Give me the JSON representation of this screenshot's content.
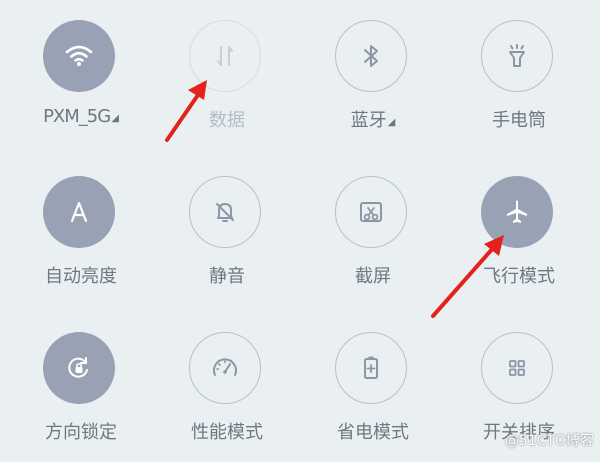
{
  "tiles": [
    {
      "label": "PXM_5G",
      "icon": "wifi-icon",
      "state": "on"
    },
    {
      "label": "数据",
      "icon": "data-transfer-icon",
      "state": "disabled"
    },
    {
      "label": "蓝牙",
      "icon": "bluetooth-icon",
      "state": "off"
    },
    {
      "label": "手电筒",
      "icon": "flashlight-icon",
      "state": "off"
    },
    {
      "label": "自动亮度",
      "icon": "brightness-auto-icon",
      "state": "on"
    },
    {
      "label": "静音",
      "icon": "bell-mute-icon",
      "state": "off"
    },
    {
      "label": "截屏",
      "icon": "screenshot-icon",
      "state": "off"
    },
    {
      "label": "飞行模式",
      "icon": "airplane-icon",
      "state": "on"
    },
    {
      "label": "方向锁定",
      "icon": "rotation-lock-icon",
      "state": "on"
    },
    {
      "label": "性能模式",
      "icon": "speedometer-icon",
      "state": "off"
    },
    {
      "label": "省电模式",
      "icon": "battery-saver-icon",
      "state": "off"
    },
    {
      "label": "开关排序",
      "icon": "grid-sort-icon",
      "state": "off"
    }
  ],
  "colors": {
    "active": "#99a2b4",
    "inactive_border": "#b7bfcb",
    "label": "#6f7784",
    "arrow": "#e3221c",
    "background": "#eaf0f1"
  },
  "watermark": "@51CTO博客"
}
